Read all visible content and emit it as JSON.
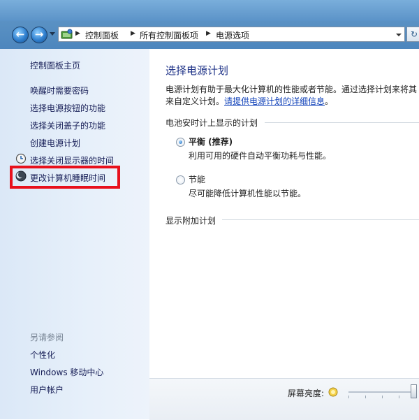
{
  "address_bar": {
    "crumbs": [
      "控制面板",
      "所有控制面板项",
      "电源选项"
    ]
  },
  "left_pane": {
    "home_link": "控制面板主页",
    "links": [
      "唤醒时需要密码",
      "选择电源按钮的功能",
      "选择关闭盖子的功能",
      "创建电源计划",
      "选择关闭显示器的时间",
      "更改计算机睡眠时间"
    ],
    "see_also_header": "另请参阅",
    "see_also": [
      "个性化",
      "Windows 移动中心",
      "用户帐户"
    ]
  },
  "main": {
    "title": "选择电源计划",
    "description_line1": "电源计划有助于最大化计算机的性能或者节能。通过选择计划来将其",
    "description_line2_prefix": "来自定义计划。",
    "description_link": "请提供电源计划的详细信息",
    "description_suffix": "。",
    "group_label": "电池安时计上显示的计划",
    "plans": [
      {
        "name": "平衡 (推荐)",
        "description": "利用可用的硬件自动平衡功耗与性能。",
        "selected": true
      },
      {
        "name": "节能",
        "description": "尽可能降低计算机性能以节能。",
        "selected": false
      }
    ],
    "extra_plans_label": "显示附加计划"
  },
  "bottom_bar": {
    "brightness_label": "屏幕亮度:",
    "brightness_level_percent": 98
  },
  "colors": {
    "link": "#151c55",
    "title": "#1e3287",
    "highlight_box": "#e8101c"
  }
}
